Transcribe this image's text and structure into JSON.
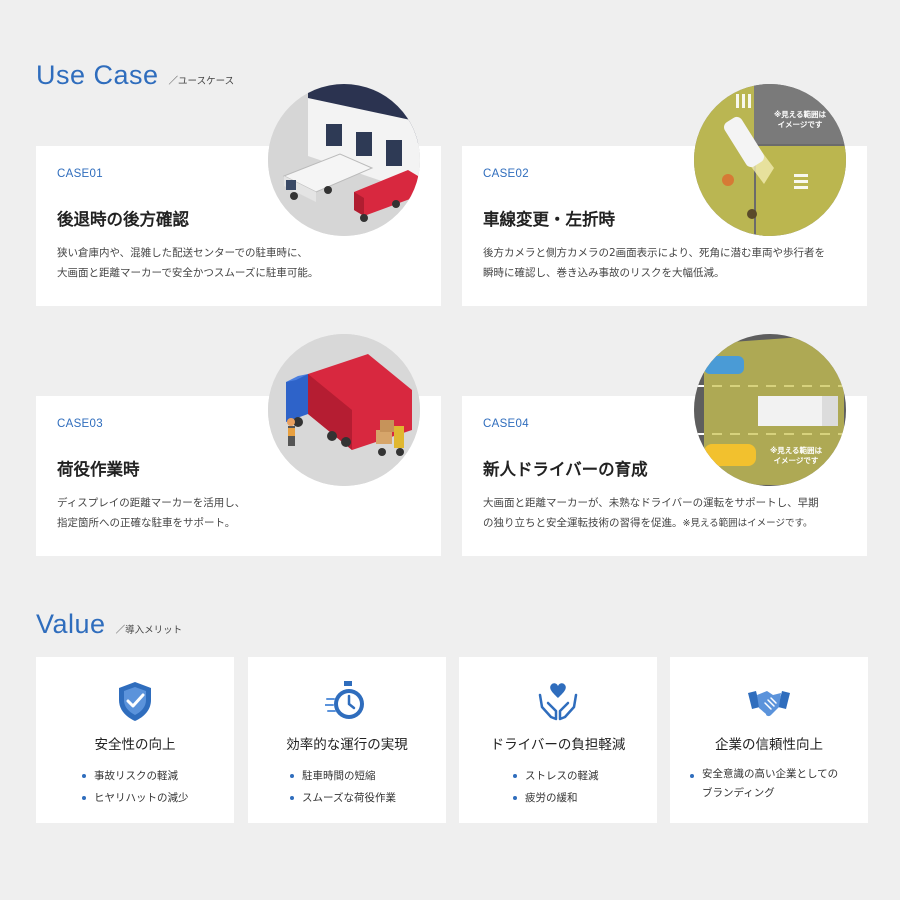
{
  "usecase": {
    "title_en": "Use Case",
    "title_ja": "／ユースケース",
    "cards": [
      {
        "label": "CASE01",
        "title": "後退時の後方確認",
        "desc_line1": "狭い倉庫内や、混雑した配送センターでの駐車時に、",
        "desc_line2": "大画面と距離マーカーで安全かつスムーズに駐車可能。"
      },
      {
        "label": "CASE02",
        "title": "車線変更・左折時",
        "desc_line1": "後方カメラと側方カメラの2画面表示により、死角に潜む車両や歩行者を",
        "desc_line2": "瞬時に確認し、巻き込み事故のリスクを大幅低減。",
        "image_note": "※見える範囲は\nイメージです"
      },
      {
        "label": "CASE03",
        "title": "荷役作業時",
        "desc_line1": "ディスプレイの距離マーカーを活用し、",
        "desc_line2": "指定箇所への正確な駐車をサポート。"
      },
      {
        "label": "CASE04",
        "title": "新人ドライバーの育成",
        "desc_line1": "大画面と距離マーカーが、未熟なドライバーの運転をサポートし、早期",
        "desc_line2": "の独り立ちと安全運転技術の習得を促進。",
        "desc_note": "※見える範囲はイメージです。",
        "image_note": "※見える範囲は\nイメージです"
      }
    ]
  },
  "value": {
    "title_en": "Value",
    "title_ja": "／導入メリット",
    "cards": [
      {
        "icon": "shield-check-icon",
        "title": "安全性の向上",
        "items": [
          "事故リスクの軽減",
          "ヒヤリハットの減少"
        ]
      },
      {
        "icon": "stopwatch-icon",
        "title": "効率的な運行の実現",
        "items": [
          "駐車時間の短縮",
          "スムーズな荷役作業"
        ]
      },
      {
        "icon": "heart-hands-icon",
        "title": "ドライバーの負担軽減",
        "items": [
          "ストレスの軽減",
          "疲労の緩和"
        ]
      },
      {
        "icon": "handshake-icon",
        "title": "企業の信頼性向上",
        "items": [
          "安全意識の高い企業としての",
          "ブランディング"
        ]
      }
    ]
  },
  "colors": {
    "accent": "#2f6dbd",
    "background": "#efefef",
    "card": "#ffffff"
  }
}
